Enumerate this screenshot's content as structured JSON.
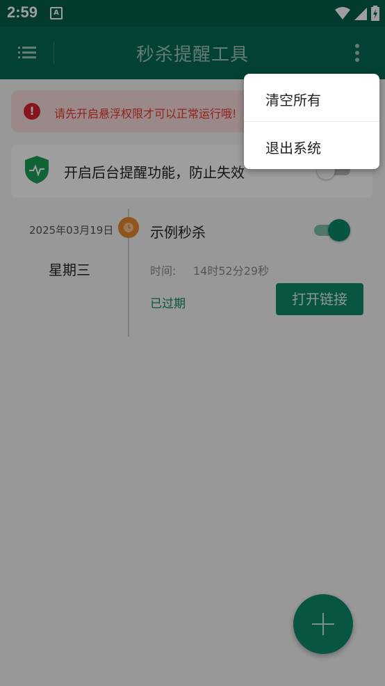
{
  "status_bar": {
    "time": "2:59",
    "notification_icon": "A"
  },
  "app_bar": {
    "title": "秒杀提醒工具",
    "menu_icon": "list-icon",
    "more_icon": "more-vert-icon"
  },
  "warning": {
    "text": "请先开启悬浮权限才可以正常运行哦!"
  },
  "background_reminder": {
    "label": "开启后台提醒功能，防止失效",
    "enabled": false
  },
  "task": {
    "date": "2025年03月19日",
    "weekday": "星期三",
    "title": "示例秒杀",
    "enabled": true,
    "time_label": "时间:",
    "time_value": "14时52分29秒",
    "status": "已过期",
    "open_button": "打开链接"
  },
  "overflow_menu": {
    "items": [
      "清空所有",
      "退出系统"
    ]
  },
  "fab": {
    "icon": "plus-icon"
  },
  "colors": {
    "primary": "#066a54",
    "status_bar": "#045e4a",
    "accent": "#0e8b6b",
    "warning_red": "#d9232e",
    "clock_orange": "#e68a2e"
  }
}
